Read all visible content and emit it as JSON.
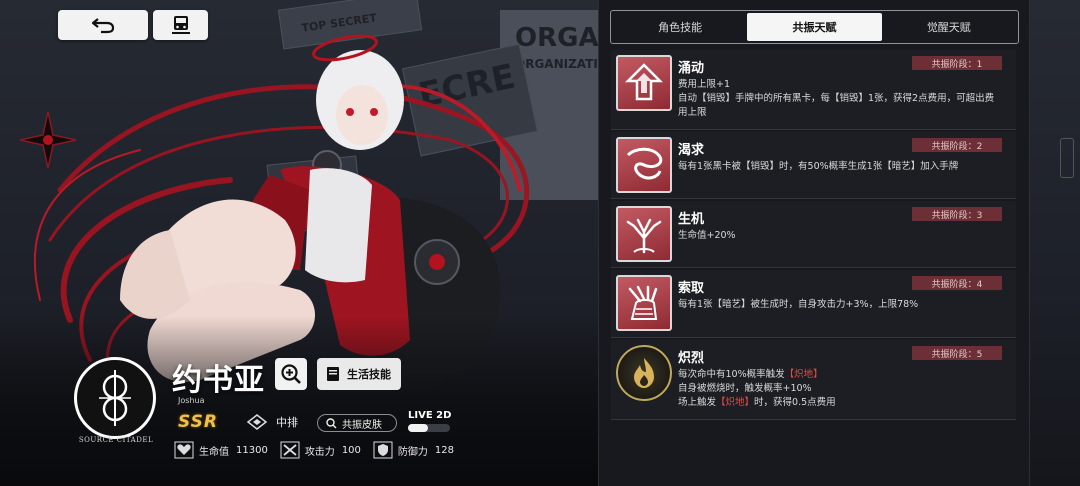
{
  "background": {
    "paper_top_secret": "TOP SECRET",
    "paper_org_title": "ORGAN",
    "paper_org_sub": "ORGANIZATIO",
    "paper_secret": "ECRE"
  },
  "topbar": {
    "back_icon": "return-arrow-icon",
    "train_icon": "train-icon"
  },
  "character": {
    "name": "约书亚",
    "name_en": "Joshua",
    "faction": "SOURCE CITADEL",
    "rarity": "SSR",
    "position": "中排",
    "life_skill_label": "生活技能",
    "skin_label": "共振皮肤",
    "live2d_label": "LIVE 2D",
    "live2d_enabled": true,
    "stats": [
      {
        "icon": "heart-icon",
        "label": "生命值",
        "value": "11300"
      },
      {
        "icon": "swords-icon",
        "label": "攻击力",
        "value": "100"
      },
      {
        "icon": "shield-icon",
        "label": "防御力",
        "value": "128"
      }
    ],
    "accent_color": "#b3121f"
  },
  "tabs": [
    {
      "label": "角色技能",
      "active": false
    },
    {
      "label": "共振天赋",
      "active": true
    },
    {
      "label": "觉醒天赋",
      "active": false
    }
  ],
  "talents": [
    {
      "name": "涌动",
      "stage": "共振阶段：1",
      "icon": "upward-arrow-icon",
      "desc": [
        "费用上限+1",
        "自动【销毁】手牌中的所有黑卡，每【销毁】1张，获得2点费用，可超出费用上限"
      ]
    },
    {
      "name": "渴求",
      "stage": "共振阶段：2",
      "icon": "swirl-icon",
      "desc": [
        "每有1张黑卡被【销毁】时，有50%概率生成1张【暗艺】加入手牌"
      ]
    },
    {
      "name": "生机",
      "stage": "共振阶段：3",
      "icon": "tree-icon",
      "desc": [
        "生命值+20%"
      ]
    },
    {
      "name": "索取",
      "stage": "共振阶段：4",
      "icon": "grasping-hand-icon",
      "desc": [
        "每有1张【暗艺】被生成时，自身攻击力+3%，上限78%"
      ]
    },
    {
      "name": "炽烈",
      "stage": "共振阶段：5",
      "icon": "flame-icon",
      "desc_parts": [
        {
          "pre": "每次命中有10%概率触发",
          "hl": "【炽地】",
          "post": ""
        },
        {
          "pre": "自身被燃烧时，触发概率+10%",
          "hl": "",
          "post": ""
        },
        {
          "pre": "场上触发",
          "hl": "【炽地】",
          "post": "时，获得0.5点费用"
        }
      ]
    }
  ]
}
